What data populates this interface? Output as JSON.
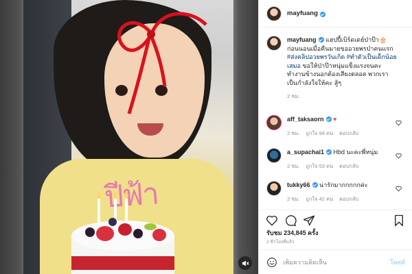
{
  "post": {
    "username": "mayfuang",
    "caption_line1": "แฮปปี้เบิร์ดเดย์ป่าป๊า🎂",
    "caption_line2": "ก่อนนอนเมื่อคืนมายขออวยพรป่าคนแรก",
    "caption_hashtag1": "#ส่งคลิปอวยพรวันเกิด",
    "caption_hashtag2": "#ทำตัวเป็นเด็กน้อยเสมอ",
    "caption_line4": "ขอให้ป่าป๊าหนุ่มแข็งแรงจนคะ",
    "caption_line5": "ทำงานข้างนอกต้องเสียงตลอด พวกเรา",
    "caption_line6": "เป็นกำลังใจให้คะ สู้ๆ",
    "caption_time": "2 ชม."
  },
  "comments": [
    {
      "user": "aff_taksaorn",
      "text": "",
      "emoji": "♥",
      "time": "2 ชม.",
      "likes": "ถูกใจ 94 คน",
      "reply": "ตอบกลับ"
    },
    {
      "user": "a_supachai1",
      "text": "Hbd นะคะพี่หนุ่ม",
      "time": "2 ชม.",
      "likes": "ถูกใจ 53 คน",
      "reply": "ตอบกลับ"
    },
    {
      "user": "tukky66",
      "text": "น่ารักมากกกกกค่ะ",
      "time": "2 ชม.",
      "likes": "ถูกใจ 42 คน",
      "reply": "ตอบกลับ"
    }
  ],
  "likes_label": "รับชม",
  "likes_count": "234,845 ครั้ง",
  "time_ago": "2 ชั่วโมงที่แล้ว",
  "add_comment_placeholder": "เพิ่มความคิดเห็น",
  "post_button": "โพสต์",
  "icons": {
    "like": "heart-icon",
    "comment": "comment-icon",
    "share": "share-icon",
    "save": "bookmark-icon",
    "emoji": "emoji-icon",
    "mute": "speaker-icon"
  },
  "colors": {
    "hashtag": "#00376b",
    "verified": "#3897f0",
    "post_button": "#b2dffc",
    "ribbon": "#d8121d"
  }
}
